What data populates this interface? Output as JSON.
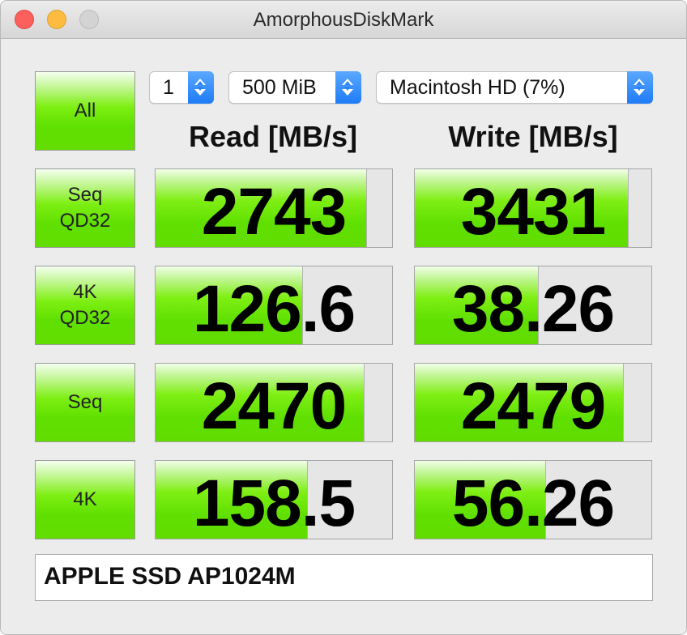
{
  "window": {
    "title": "AmorphousDiskMark"
  },
  "controls": {
    "count": "1",
    "size": "500 MiB",
    "drive": "Macintosh HD (7%)"
  },
  "headers": {
    "read": "Read [MB/s]",
    "write": "Write [MB/s]"
  },
  "buttons": {
    "all": "All",
    "seq_qd32": [
      "Seq",
      "QD32"
    ],
    "k4_qd32": [
      "4K",
      "QD32"
    ],
    "seq": "Seq",
    "k4": "4K"
  },
  "results": {
    "seq_qd32": {
      "read": "2743",
      "write": "3431",
      "read_fill": 0.89,
      "write_fill": 0.9
    },
    "k4_qd32": {
      "read": "126.6",
      "write": "38.26",
      "read_fill": 0.62,
      "write_fill": 0.52
    },
    "seq": {
      "read": "2470",
      "write": "2479",
      "read_fill": 0.88,
      "write_fill": 0.88
    },
    "k4": {
      "read": "158.5",
      "write": "56.26",
      "read_fill": 0.64,
      "write_fill": 0.55
    }
  },
  "device": {
    "name": "APPLE SSD AP1024M"
  },
  "colors": {
    "accent_green": "#5fe000",
    "select_blue": "#2b86f8"
  }
}
